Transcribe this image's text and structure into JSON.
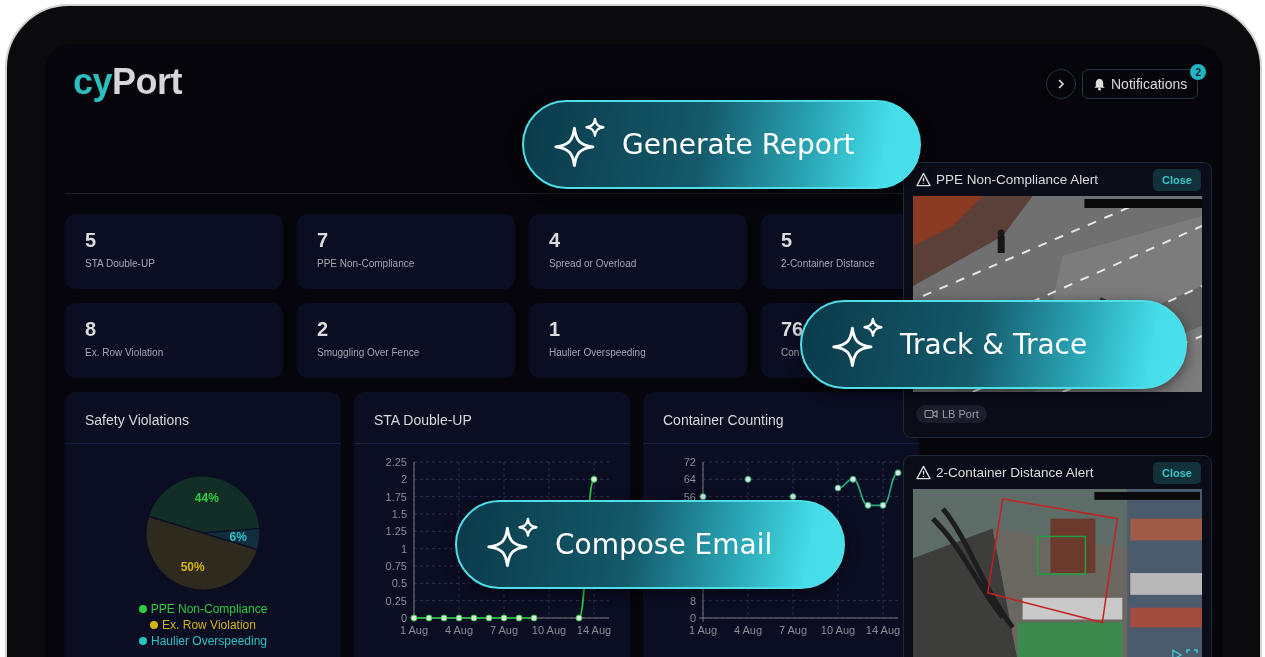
{
  "logo": {
    "prefix": "cy",
    "suffix": "Port"
  },
  "header": {
    "notifications": {
      "label": "Notifications",
      "badge": "2"
    }
  },
  "stats": [
    {
      "value": "5",
      "label": "STA Double-UP"
    },
    {
      "value": "7",
      "label": "PPE Non-Compliance"
    },
    {
      "value": "4",
      "label": "Spread or Overload"
    },
    {
      "value": "5",
      "label": "2-Container Distance"
    },
    {
      "value": "8",
      "label": "Ex. Row Violation"
    },
    {
      "value": "2",
      "label": "Smuggling Over Fence"
    },
    {
      "value": "1",
      "label": "Haulier Overspeeding"
    },
    {
      "value": "76",
      "label": "Con"
    }
  ],
  "panels": [
    {
      "title": "Safety Violations",
      "chart_data": {
        "type": "pie",
        "categories": [
          "PPE Non-Compliance",
          "Ex. Row Violation",
          "Haulier Overspeeding"
        ],
        "values": [
          44,
          50,
          6
        ],
        "value_labels": [
          "44%",
          "50%",
          "6%"
        ]
      },
      "legend": [
        {
          "color": "#2ecc40"
        },
        {
          "color": "#d4b312"
        },
        {
          "color": "#2bc4c4"
        }
      ]
    },
    {
      "title": "STA Double-UP",
      "chart_data": {
        "type": "line",
        "categories": [
          "1 Aug",
          null,
          null,
          "4 Aug",
          null,
          null,
          "7 Aug",
          null,
          null,
          "10 Aug",
          null,
          null,
          "14 Aug"
        ],
        "grid": true,
        "ylim": [
          0,
          2.25
        ],
        "yticks": [
          0,
          0.25,
          0.5,
          0.75,
          1,
          1.25,
          1.5,
          1.75,
          2,
          2.25
        ],
        "series": [
          {
            "color": "#2ecc40",
            "marker": true,
            "values": [
              0,
              0,
              0,
              0,
              0,
              0,
              0,
              0,
              0,
              null,
              null,
              0,
              2
            ]
          }
        ]
      }
    },
    {
      "title": "Container Counting",
      "chart_data": {
        "type": "line",
        "categories": [
          "1 Aug",
          null,
          null,
          "4 Aug",
          null,
          null,
          "7 Aug",
          null,
          null,
          "10 Aug",
          null,
          null,
          "14 Aug",
          null
        ],
        "grid": true,
        "ylim": [
          0,
          72
        ],
        "yticks": [
          0,
          8,
          56,
          64,
          72
        ],
        "series": [
          {
            "color": "#2aa87a",
            "marker": true,
            "values": [
              56,
              null,
              null,
              64,
              null,
              null,
              56,
              null,
              null,
              60,
              64,
              52,
              52,
              67
            ]
          }
        ]
      }
    }
  ],
  "alerts": [
    {
      "title": "PPE Non-Compliance Alert",
      "close": "Close",
      "tag": "LB Port"
    },
    {
      "title": "2-Container Distance Alert",
      "close": "Close",
      "media_controls": true
    }
  ],
  "actions": [
    {
      "label": "Generate Report"
    },
    {
      "label": "Track & Trace"
    },
    {
      "label": "Compose Email"
    }
  ]
}
